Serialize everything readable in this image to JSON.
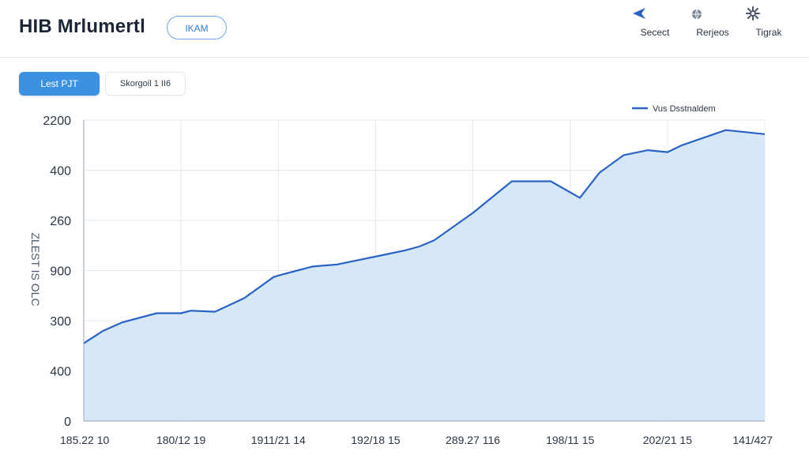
{
  "header": {
    "title": "HIB Mrlumertl",
    "pill_label": "IKAM",
    "actions": [
      {
        "label": "Secect",
        "icon": "send-icon"
      },
      {
        "label": "Rerjeos",
        "icon": "globe-icon"
      },
      {
        "label": "Tigrak",
        "icon": "gear-icon"
      }
    ]
  },
  "toolbar": {
    "primary_label": "Lest PJT",
    "secondary_label": "Skorgoil 1 II6"
  },
  "colors": {
    "accent": "#3c92e2",
    "line": "#2a63c6",
    "area": "#cfe3f7",
    "grid": "#e4e9f0"
  },
  "chart_data": {
    "type": "area",
    "legend": [
      "Vus Dsstnaldem"
    ],
    "legend_position": "top-right",
    "ylabel": "ZLEST IS OLC",
    "y_ticks": [
      "0",
      "400",
      "300",
      "900",
      "260",
      "400",
      "2200"
    ],
    "x_ticks": [
      "185.22 10",
      "180/12 19",
      "1911/21 14",
      "192/18 15",
      "289.27 116",
      "198/11 15",
      "202/21 15",
      "141/427"
    ],
    "grid": true,
    "x_range": [
      0,
      7
    ],
    "y_range": [
      0,
      6
    ],
    "series": [
      {
        "name": "Vus Dsstnaldem",
        "x": [
          0,
          0.2,
          0.4,
          0.75,
          1.0,
          1.1,
          1.35,
          1.65,
          1.95,
          2.0,
          2.35,
          2.6,
          2.8,
          3.05,
          3.3,
          3.45,
          3.6,
          4.0,
          4.4,
          4.8,
          5.1,
          5.3,
          5.55,
          5.8,
          6.0,
          6.15,
          6.6,
          7.0
        ],
        "y": [
          1.55,
          1.8,
          1.97,
          2.15,
          2.15,
          2.2,
          2.18,
          2.45,
          2.87,
          2.9,
          3.08,
          3.12,
          3.2,
          3.3,
          3.4,
          3.48,
          3.6,
          4.15,
          4.78,
          4.78,
          4.45,
          4.95,
          5.3,
          5.4,
          5.36,
          5.5,
          5.8,
          5.72
        ]
      }
    ]
  }
}
